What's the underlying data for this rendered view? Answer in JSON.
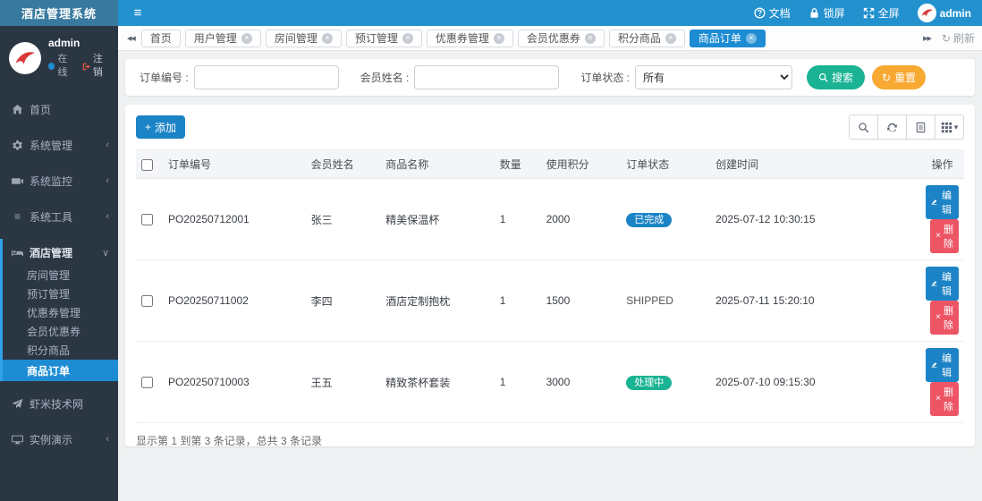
{
  "app": {
    "title": "酒店管理系统"
  },
  "header": {
    "docs": "文档",
    "lock": "锁屏",
    "fullscreen": "全屏",
    "username": "admin"
  },
  "sidebar": {
    "username": "admin",
    "online_label": "在线",
    "logout_label": "注销",
    "menu": [
      {
        "label": "首页",
        "icon": "home-icon"
      },
      {
        "label": "系统管理",
        "icon": "gear-icon"
      },
      {
        "label": "系统监控",
        "icon": "monitor-icon"
      },
      {
        "label": "系统工具",
        "icon": "list-icon"
      },
      {
        "label": "酒店管理",
        "icon": "bed-icon"
      }
    ],
    "submenu": [
      {
        "label": "房间管理"
      },
      {
        "label": "预订管理"
      },
      {
        "label": "优惠券管理"
      },
      {
        "label": "会员优惠券"
      },
      {
        "label": "积分商品"
      },
      {
        "label": "商品订单",
        "active": true
      }
    ],
    "extra": [
      {
        "label": "虾米技术网",
        "icon": "paper-plane-icon"
      },
      {
        "label": "实例演示",
        "icon": "desktop-icon"
      }
    ]
  },
  "tabs": {
    "items": [
      {
        "label": "首页"
      },
      {
        "label": "用户管理"
      },
      {
        "label": "房间管理"
      },
      {
        "label": "预订管理"
      },
      {
        "label": "优惠券管理"
      },
      {
        "label": "会员优惠券"
      },
      {
        "label": "积分商品"
      },
      {
        "label": "商品订单"
      }
    ],
    "refresh_label": "刷新"
  },
  "search": {
    "order_no_label": "订单编号 :",
    "member_label": "会员姓名 :",
    "status_label": "订单状态 :",
    "status_value": "所有",
    "search_btn": "搜索",
    "reset_btn": "重置"
  },
  "toolbar": {
    "add_btn": "添加"
  },
  "table": {
    "columns": [
      "订单编号",
      "会员姓名",
      "商品名称",
      "数量",
      "使用积分",
      "订单状态",
      "创建时间",
      "操作"
    ],
    "rows": [
      {
        "order_no": "PO20250712001",
        "member": "张三",
        "product": "精美保温杯",
        "qty": "1",
        "points": "2000",
        "status": "已完成",
        "created": "2025-07-12 10:30:15"
      },
      {
        "order_no": "PO20250711002",
        "member": "李四",
        "product": "酒店定制抱枕",
        "qty": "1",
        "points": "1500",
        "status": "SHIPPED",
        "created": "2025-07-11 15:20:10"
      },
      {
        "order_no": "PO20250710003",
        "member": "王五",
        "product": "精致茶杯套装",
        "qty": "1",
        "points": "3000",
        "status": "处理中",
        "created": "2025-07-10 09:15:30"
      }
    ],
    "edit_btn": "编辑",
    "delete_btn": "删除",
    "summary": "显示第 1 到第 3 条记录，总共 3 条记录"
  },
  "colors": {
    "header_blue": "#2491cf",
    "logo_blue": "#38799f",
    "sidebar_bg": "#2b3643",
    "active_blue": "#1d8cd3",
    "accent_blue": "#1c84c6",
    "green": "#1ab394",
    "orange": "#f8a932",
    "red": "#ed5565"
  }
}
